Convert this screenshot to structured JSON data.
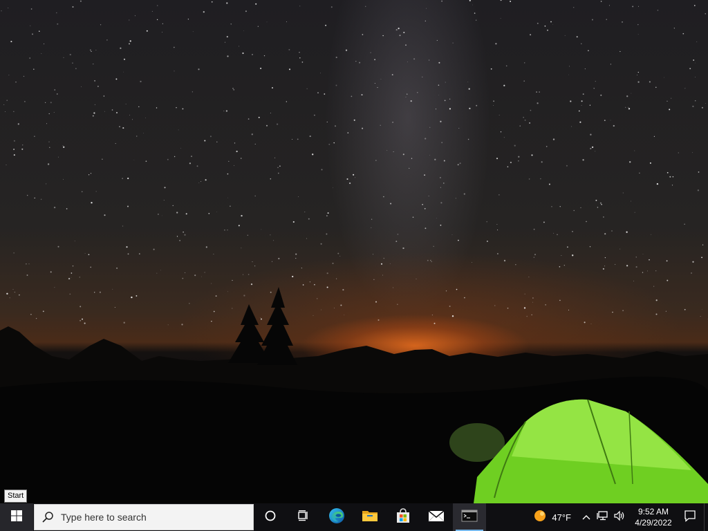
{
  "desktop": {
    "wallpaper": "milky-way-night-sky-with-green-tent"
  },
  "tooltip": {
    "text": "Start"
  },
  "taskbar": {
    "start": {
      "icon": "windows-logo-icon"
    },
    "search": {
      "placeholder": "Type here to search",
      "icon": "search-icon"
    },
    "pinned": [
      {
        "name": "cortana",
        "icon": "circle-icon"
      },
      {
        "name": "task-view",
        "icon": "task-view-icon"
      },
      {
        "name": "edge",
        "icon": "edge-icon"
      },
      {
        "name": "file-explorer",
        "icon": "folder-icon"
      },
      {
        "name": "microsoft-store",
        "icon": "store-icon"
      },
      {
        "name": "mail",
        "icon": "mail-icon"
      },
      {
        "name": "command-prompt",
        "icon": "terminal-icon",
        "active": true
      }
    ],
    "tray": {
      "weather": {
        "temp": "47°F",
        "icon": "sun-cloud-icon"
      },
      "icons": [
        "chevron-up-icon",
        "network-icon",
        "volume-icon"
      ],
      "time": "9:52 AM",
      "date": "4/29/2022",
      "notifications_icon": "notification-icon"
    }
  },
  "colors": {
    "taskbar": "#0f0f12",
    "accent": "#76b9ed",
    "tent": "#8fe03a"
  }
}
